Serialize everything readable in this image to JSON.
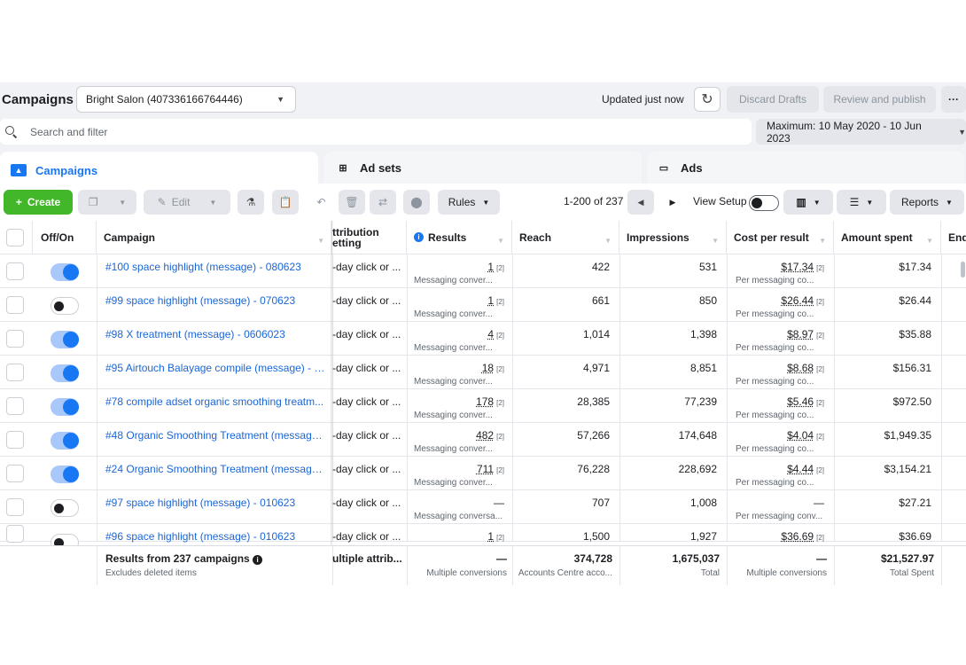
{
  "header": {
    "title": "Campaigns",
    "account": "Bright Salon (407336166764446)",
    "updated": "Updated just now",
    "discard_label": "Discard Drafts",
    "review_label": "Review and publish",
    "more_label": "···"
  },
  "search": {
    "placeholder": "Search and filter",
    "date_range": "Maximum: 10 May 2020 - 10 Jun 2023"
  },
  "tabs": [
    {
      "label": "Campaigns",
      "icon": "folder-icon",
      "active": true
    },
    {
      "label": "Ad sets",
      "icon": "grid-icon",
      "active": false
    },
    {
      "label": "Ads",
      "icon": "ad-frame-icon",
      "active": false
    }
  ],
  "toolbar": {
    "create_label": "Create",
    "edit_label": "Edit",
    "rules_label": "Rules",
    "paging": "1-200 of 237",
    "view_setup": "View Setup",
    "reports_label": "Reports"
  },
  "table": {
    "columns": [
      "Off/On",
      "Campaign",
      "Attribution setting",
      "Results",
      "Reach",
      "Impressions",
      "Cost per result",
      "Amount spent",
      "End"
    ],
    "attribution_header_visible": "ttribution\netting",
    "rows": [
      {
        "on": true,
        "campaign": "#100 space highlight (message) - 080623",
        "attribution": "-day click or ...",
        "results": "1",
        "results_sub": "Messaging conver...",
        "reach": "422",
        "impressions": "531",
        "cpr": "$17.34",
        "cpr_sub": "Per messaging co...",
        "spent": "$17.34"
      },
      {
        "on": false,
        "campaign": "#99 space highlight (message) - 070623",
        "attribution": "-day click or ...",
        "results": "1",
        "results_sub": "Messaging conver...",
        "reach": "661",
        "impressions": "850",
        "cpr": "$26.44",
        "cpr_sub": "Per messaging co...",
        "spent": "$26.44"
      },
      {
        "on": true,
        "campaign": "#98 X treatment (message) - 0606023",
        "attribution": "-day click or ...",
        "results": "4",
        "results_sub": "Messaging conver...",
        "reach": "1,014",
        "impressions": "1,398",
        "cpr": "$8.97",
        "cpr_sub": "Per messaging co...",
        "spent": "$35.88"
      },
      {
        "on": true,
        "campaign": "#95 Airtouch Balayage compile (message) - 2...",
        "attribution": "-day click or ...",
        "results": "18",
        "results_sub": "Messaging conver...",
        "reach": "4,971",
        "impressions": "8,851",
        "cpr": "$8.68",
        "cpr_sub": "Per messaging co...",
        "spent": "$156.31"
      },
      {
        "on": true,
        "campaign": "#78 compile adset organic smoothing treatm...",
        "attribution": "-day click or ...",
        "results": "178",
        "results_sub": "Messaging conver...",
        "reach": "28,385",
        "impressions": "77,239",
        "cpr": "$5.46",
        "cpr_sub": "Per messaging co...",
        "spent": "$972.50"
      },
      {
        "on": true,
        "campaign": "#48 Organic Smoothing Treatment (message...",
        "attribution": "-day click or ...",
        "results": "482",
        "results_sub": "Messaging conver...",
        "reach": "57,266",
        "impressions": "174,648",
        "cpr": "$4.04",
        "cpr_sub": "Per messaging co...",
        "spent": "$1,949.35"
      },
      {
        "on": true,
        "campaign": "#24 Organic Smoothing Treatment (message...",
        "attribution": "-day click or ...",
        "results": "711",
        "results_sub": "Messaging conver...",
        "reach": "76,228",
        "impressions": "228,692",
        "cpr": "$4.44",
        "cpr_sub": "Per messaging co...",
        "spent": "$3,154.21"
      },
      {
        "on": false,
        "campaign": "#97 space highlight (message) - 010623",
        "attribution": "-day click or ...",
        "results": "—",
        "results_sub": "Messaging conversa...",
        "reach": "707",
        "impressions": "1,008",
        "cpr": "—",
        "cpr_sub": "Per messaging conv...",
        "spent": "$27.21"
      },
      {
        "on": false,
        "campaign": "#96 space highlight (message) - 010623",
        "attribution": "-day click or ...",
        "results": "1",
        "results_sub": "",
        "reach": "1,500",
        "impressions": "1,927",
        "cpr": "$36.69",
        "cpr_sub": "",
        "spent": "$36.69"
      }
    ],
    "footnote_mark": "[2]",
    "totals": {
      "label": "Results from 237 campaigns",
      "sub": "Excludes deleted items",
      "attribution": "ultiple attrib...",
      "results": "—",
      "results_sub": "Multiple conversions",
      "reach": "374,728",
      "reach_sub": "Accounts Centre acco...",
      "impressions": "1,675,037",
      "impressions_sub": "Total",
      "cpr": "—",
      "cpr_sub": "Multiple conversions",
      "spent": "$21,527.97",
      "spent_sub": "Total Spent"
    }
  }
}
